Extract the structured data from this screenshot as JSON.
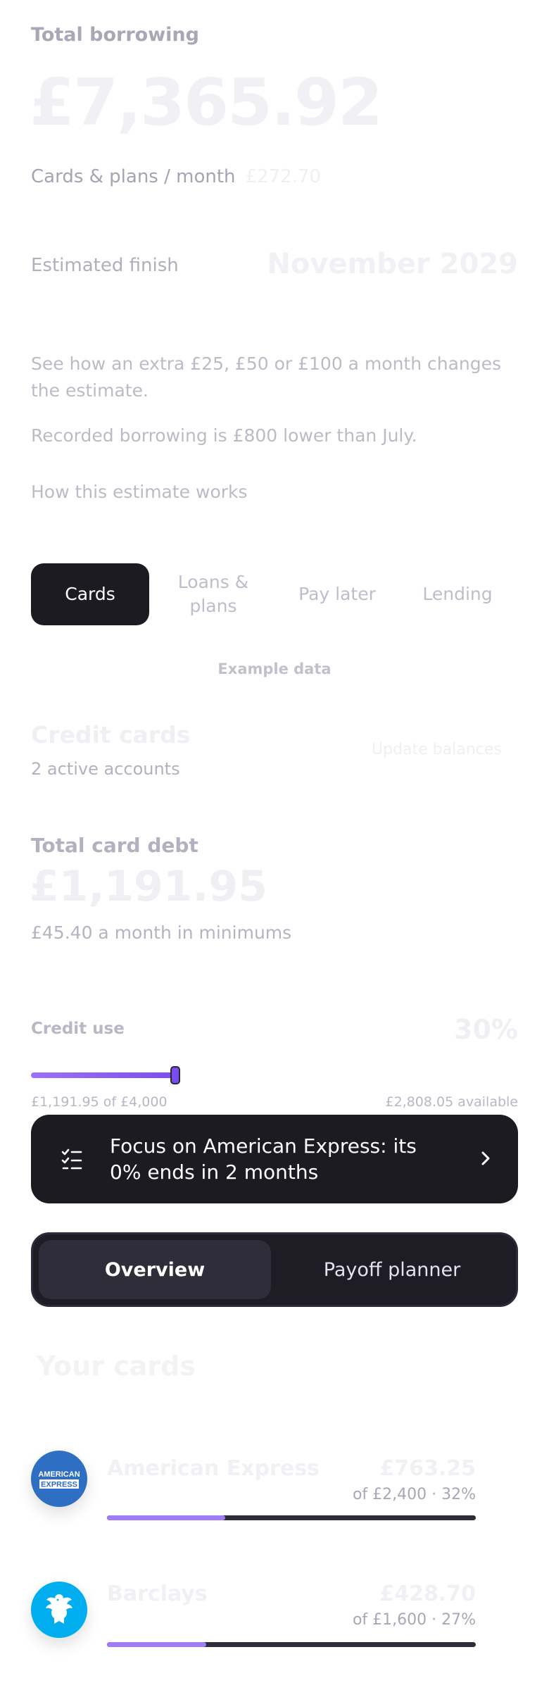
{
  "summary": {
    "total_label": "Total borrowing",
    "total_amount": "£7,365.92",
    "cards_plans_label": "Cards & plans / month",
    "cards_plans_value": "£272.70",
    "estimated_finish_label": "Estimated finish",
    "estimated_finish_value": "November 2029",
    "extra_description": "See how an extra £25, £50 or £100 a month changes the estimate.",
    "recorded_note": "Recorded borrowing is £800 lower than July.",
    "how_link": "How this estimate works"
  },
  "tabs": [
    {
      "label": "Cards",
      "active": true
    },
    {
      "label": "Loans & plans",
      "active": false
    },
    {
      "label": "Pay later",
      "active": false
    },
    {
      "label": "Lending",
      "active": false
    }
  ],
  "example_note": "Example data",
  "credit_cards": {
    "title": "Credit cards",
    "subtitle": "2 active accounts",
    "update_label": "Update balances",
    "total_debt_label": "Total card debt",
    "total_debt_amount": "£1,191.95",
    "minimums": "£45.40 a month in minimums",
    "credit_use_label": "Credit use",
    "credit_use_pct": "30%",
    "credit_use_fraction": 0.3,
    "used_of_limit": "£1,191.95 of £4,000",
    "available": "£2,808.05 available"
  },
  "focus_banner": {
    "icon": "checklist-icon",
    "text": "Focus on American Express: its 0% ends in 2 months"
  },
  "segmented": {
    "overview": "Overview",
    "payoff": "Payoff planner"
  },
  "your_cards": {
    "title": "Your cards",
    "cards": [
      {
        "name": "American Express",
        "amount": "£763.25",
        "detail": "of £2,400 · 32%",
        "fraction": 0.32,
        "logo_text_1": "AMERICAN",
        "logo_text_2": "EXPRESS",
        "color": "#2f6fc3"
      },
      {
        "name": "Barclays",
        "amount": "£428.70",
        "detail": "of £1,600 · 27%",
        "fraction": 0.27,
        "color": "#00aeef"
      }
    ]
  }
}
